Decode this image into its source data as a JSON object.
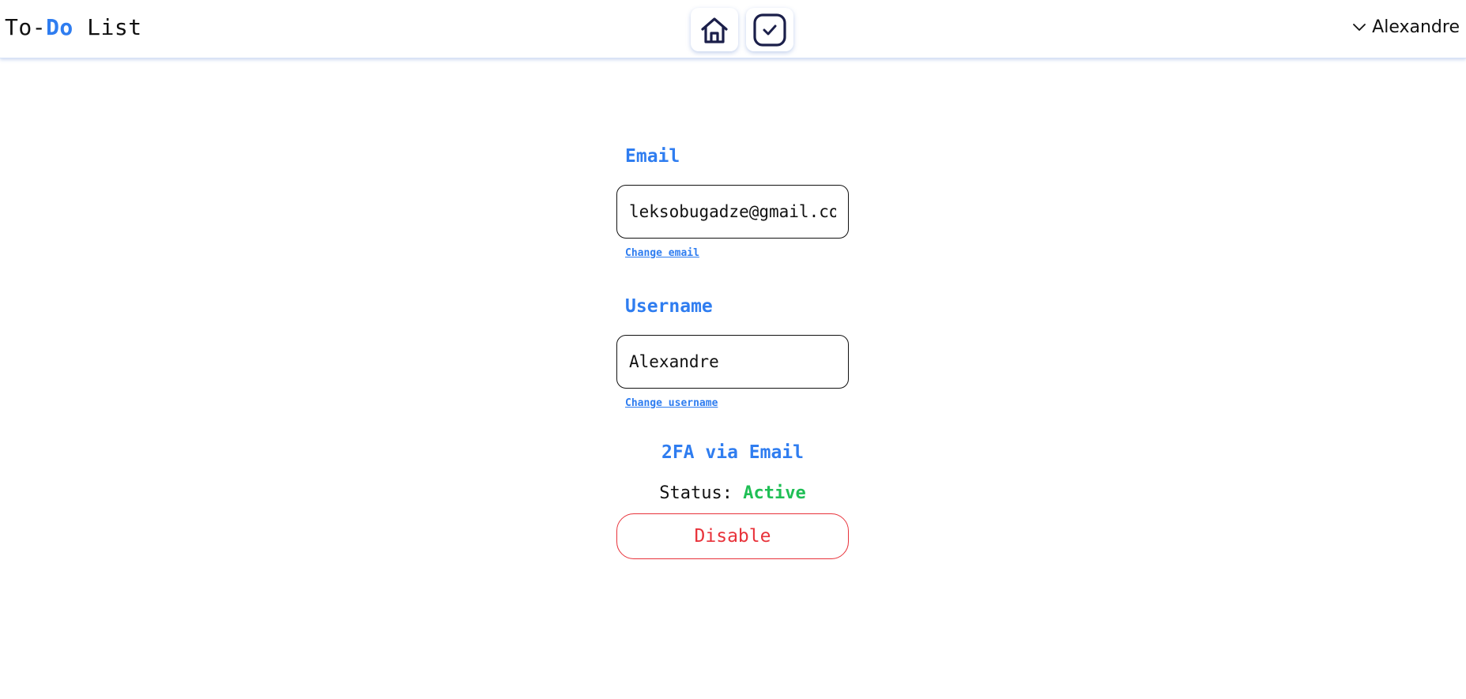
{
  "header": {
    "logo_prefix": "To-",
    "logo_accent": "Do",
    "logo_suffix": " List",
    "nav": [
      {
        "icon": "home-icon"
      },
      {
        "icon": "checkbox-icon"
      }
    ],
    "user": {
      "name": "Alexandre",
      "icon": "chevron-down-icon"
    }
  },
  "email": {
    "label": "Email",
    "value": "leksobugadze@gmail.com",
    "change_link": "Change email"
  },
  "username": {
    "label": "Username",
    "value": "Alexandre",
    "change_link": "Change username"
  },
  "twofa": {
    "title": "2FA via Email",
    "status_label": "Status: ",
    "status_value": "Active",
    "button_label": "Disable"
  },
  "colors": {
    "accent": "#2f7df0",
    "active": "#1fbf55",
    "danger": "#e8323a",
    "icon_dark": "#1b1f4a"
  }
}
